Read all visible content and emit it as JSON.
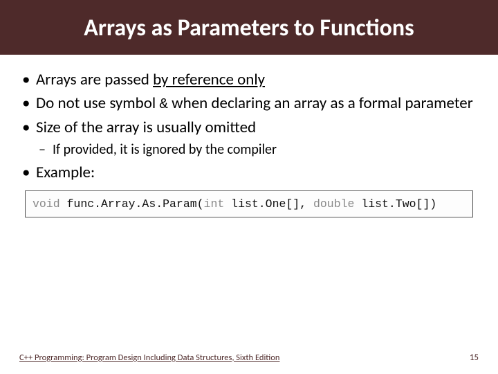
{
  "title": "Arrays as Parameters to Functions",
  "bullets": {
    "b1_pre": "Arrays are passed ",
    "b1_under": "by reference only",
    "b2_pre": "Do not use symbol ",
    "b2_amp": "&",
    "b2_post": " when declaring an array as a formal parameter",
    "b3": "Size of the array is usually omitted",
    "b3_sub": "If provided, it is ignored by the compiler",
    "b4": "Example:"
  },
  "code": {
    "kw_void": "void",
    "fn": " func.Array.As.Param(",
    "kw_int": "int",
    "p1": " list.One[], ",
    "kw_double": "double",
    "p2": " list.Two[])"
  },
  "footer": {
    "text": "C++ Programming: Program Design Including Data Structures, Sixth Edition",
    "page": "15"
  }
}
